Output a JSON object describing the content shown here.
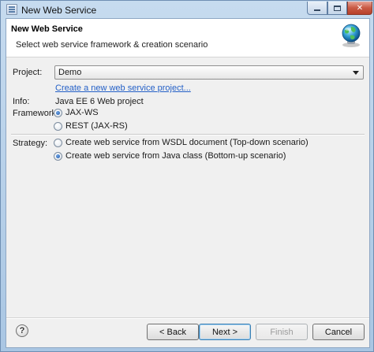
{
  "window": {
    "title": "New Web Service"
  },
  "banner": {
    "title": "New Web Service",
    "description": "Select web service framework & creation scenario",
    "icon": "web-service-globe-icon"
  },
  "form": {
    "project": {
      "label": "Project:",
      "selected": "Demo",
      "create_link": "Create a new web service project..."
    },
    "info": {
      "label": "Info:",
      "value": "Java EE 6 Web project"
    },
    "framework": {
      "label": "Framework:",
      "options": [
        {
          "label": "JAX-WS",
          "checked": true
        },
        {
          "label": "REST (JAX-RS)",
          "checked": false
        }
      ]
    },
    "strategy": {
      "label": "Strategy:",
      "options": [
        {
          "label": "Create web service from WSDL document (Top-down scenario)",
          "checked": false
        },
        {
          "label": "Create web service from Java class (Bottom-up scenario)",
          "checked": true
        }
      ]
    }
  },
  "buttons": {
    "help": "?",
    "back": "< Back",
    "next": "Next >",
    "finish": "Finish",
    "cancel": "Cancel"
  }
}
